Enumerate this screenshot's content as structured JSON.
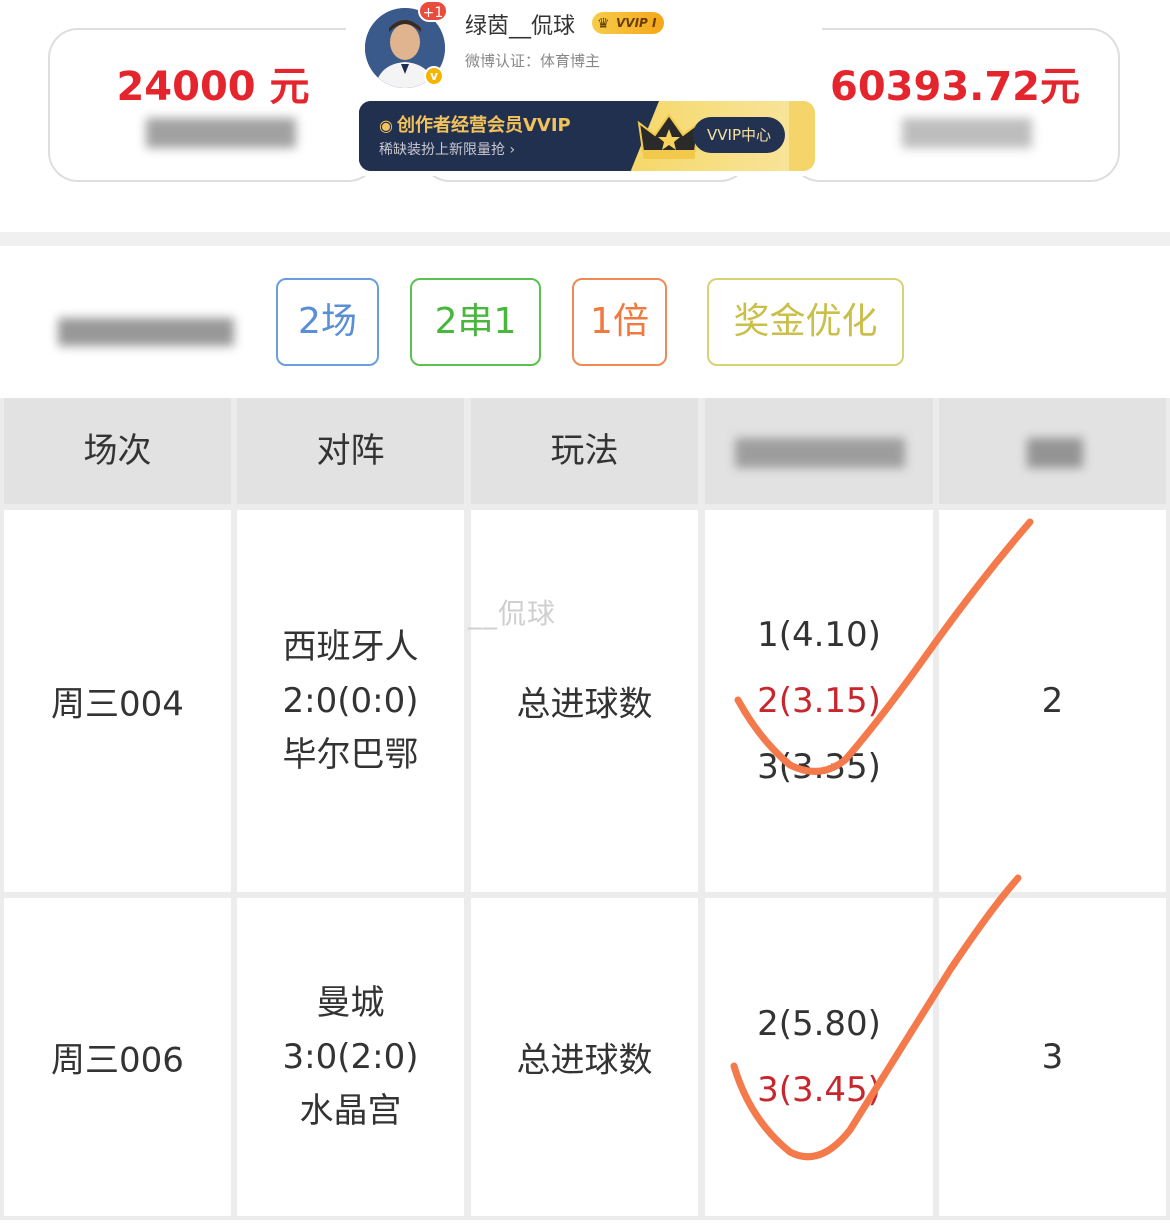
{
  "summary": {
    "left_amount": "24000 元",
    "right_amount": "60393.72元"
  },
  "profile": {
    "notification_badge": "+1",
    "username": "绿茵__侃球",
    "vvip_level": "VVIP I",
    "verification": "微博认证：体育博主"
  },
  "vvip_banner": {
    "title": "创作者经营会员VVIP",
    "subtitle": "稀缺装扮上新限量抢 ›",
    "button": "VVIP中心"
  },
  "bet_options": {
    "matches": "2场",
    "series": "2串1",
    "multiple": "1倍",
    "optimize": "奖金优化"
  },
  "table": {
    "headers": [
      "场次",
      "对阵",
      "玩法"
    ],
    "rows": [
      {
        "match_no": "周三004",
        "home": "西班牙人",
        "score": "2:0(0:0)",
        "away": "毕尔巴鄂",
        "play": "总进球数",
        "odds": [
          "1(4.10)",
          "2(3.15)",
          "3(3.35)"
        ],
        "hit_index": 1,
        "result": "2"
      },
      {
        "match_no": "周三006",
        "home": "曼城",
        "score": "3:0(2:0)",
        "away": "水晶宫",
        "play": "总进球数",
        "odds": [
          "2(5.80)",
          "3(3.45)"
        ],
        "hit_index": 1,
        "result": "3"
      }
    ]
  },
  "watermark": "__侃球",
  "colors": {
    "amount_red": "#e5252e",
    "hit_red": "#c8262d",
    "check_orange": "#f47a4c",
    "header_gray": "#e2e2e2"
  }
}
